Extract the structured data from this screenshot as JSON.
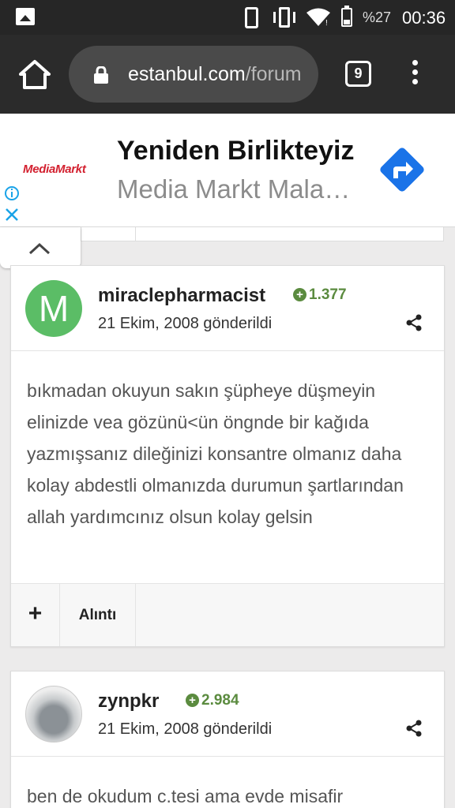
{
  "status_bar": {
    "battery": "%27",
    "time": "00:36"
  },
  "browser": {
    "url_host": "estanbul.com",
    "url_path": "/forum",
    "tab_count": "9"
  },
  "ad": {
    "brand": "MediaMarkt",
    "title": "Yeniden Birlikteyiz",
    "subtitle": "Media Markt Mala…"
  },
  "posts": [
    {
      "username": "miraclepharmacist",
      "avatar_letter": "M",
      "reputation": "1.377",
      "date": "21 Ekim, 2008 gönderildi",
      "body": "bıkmadan okuyun sakın şüpheye düşmeyin elinizde vea gözünü<ün öngnde bir kağıda yazmışsanız dileğinizi konsantre olmanız daha kolay abdestli olmanızda durumun şartlarından allah yardımcınız olsun kolay gelsin",
      "action_plus": "+",
      "action_quote": "Alıntı"
    },
    {
      "username": "zynpkr",
      "reputation": "2.984",
      "date": "21 Ekim, 2008 gönderildi",
      "body": "ben de okudum c.tesi ama evde misafir"
    }
  ],
  "colors": {
    "reputation": "#5b8b3f",
    "avatar_m": "#5bbd66",
    "ad_brand": "#d3202f",
    "ad_action": "#1a73e8"
  }
}
